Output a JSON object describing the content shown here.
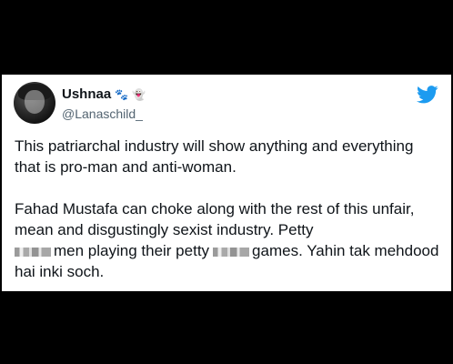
{
  "tweet": {
    "display_name": "Ushnaa",
    "handle": "@Lanaschild_",
    "emojis": [
      "🐾",
      "👻"
    ],
    "paragraph1": "This patriarchal industry will show anything and everything that is pro-man and anti-woman.",
    "paragraph2": {
      "part1": "Fahad Mustafa can choke along with the rest of this unfair, mean and disgustingly sexist industry. Petty",
      "part2": "men playing their petty",
      "part3": "games. Yahin tak mehdood hai inki soch."
    }
  },
  "icons": {
    "brand": "twitter-bird-icon",
    "avatar": "profile-avatar"
  },
  "colors": {
    "twitter_blue": "#1d9bf0",
    "text_primary": "#0f1419",
    "text_secondary": "#536471",
    "page_background": "#000000",
    "card_background": "#ffffff"
  }
}
